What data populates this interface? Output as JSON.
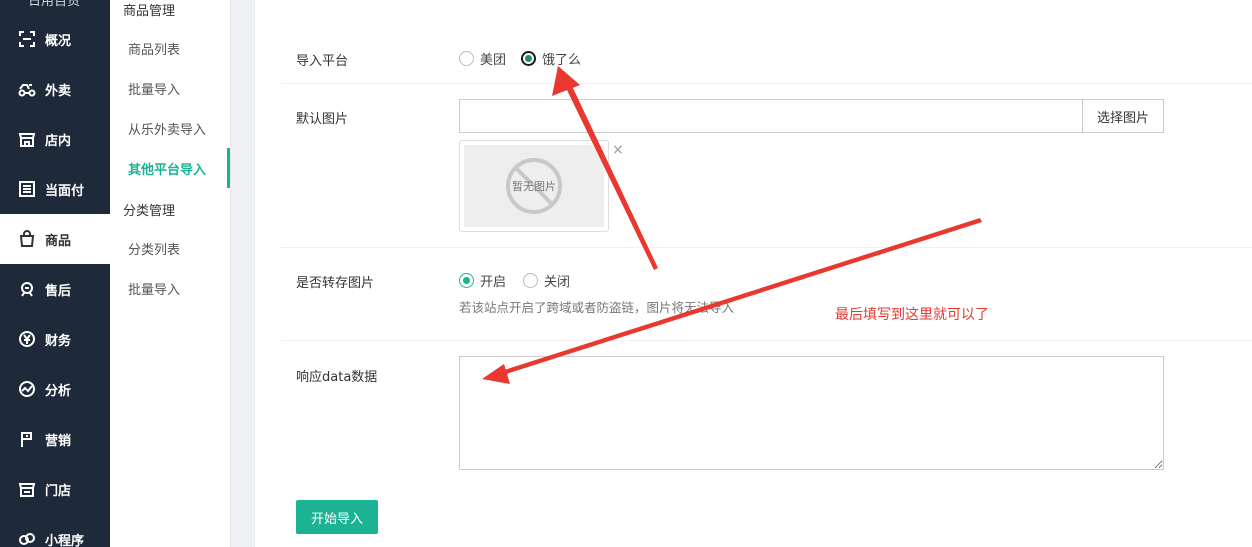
{
  "sidebar": {
    "top_label": "日用百货",
    "items": [
      {
        "icon": "overview-icon",
        "label": "概况"
      },
      {
        "icon": "delivery-icon",
        "label": "外卖"
      },
      {
        "icon": "store-icon",
        "label": "店内"
      },
      {
        "icon": "receipt-icon",
        "label": "当面付"
      },
      {
        "icon": "shopping-bag-icon",
        "label": "商品"
      },
      {
        "icon": "after-sales-icon",
        "label": "售后"
      },
      {
        "icon": "yuan-icon",
        "label": "财务"
      },
      {
        "icon": "chart-icon",
        "label": "分析"
      },
      {
        "icon": "flag-icon",
        "label": "营销"
      },
      {
        "icon": "shop-icon",
        "label": "门店"
      },
      {
        "icon": "mini-program-icon",
        "label": "小程序"
      }
    ],
    "active_index": 4
  },
  "submenu": {
    "group1": "商品管理",
    "group1_items": [
      "商品列表",
      "批量导入",
      "从乐外卖导入",
      "其他平台导入"
    ],
    "group2": "分类管理",
    "group2_items": [
      "分类列表",
      "批量导入"
    ],
    "active": "其他平台导入"
  },
  "form": {
    "platform": {
      "label": "导入平台",
      "options": [
        "美团",
        "饿了么"
      ],
      "selected": "饿了么"
    },
    "default_image": {
      "label": "默认图片",
      "value": "",
      "button": "选择图片",
      "placeholder_text": "暂无图片",
      "close_glyph": "×"
    },
    "transfer_images": {
      "label": "是否转存图片",
      "options": [
        "开启",
        "关闭"
      ],
      "selected": "开启",
      "hint": "若该站点开启了跨域或者防盗链，图片将无法导入"
    },
    "response_data": {
      "label": "响应data数据",
      "value": ""
    },
    "submit": "开始导入"
  },
  "annotation": {
    "text": "最后填写到这里就可以了",
    "color": "#e8382f"
  },
  "colors": {
    "accent": "#1cb394",
    "sidebar_bg": "#1e2a39"
  }
}
